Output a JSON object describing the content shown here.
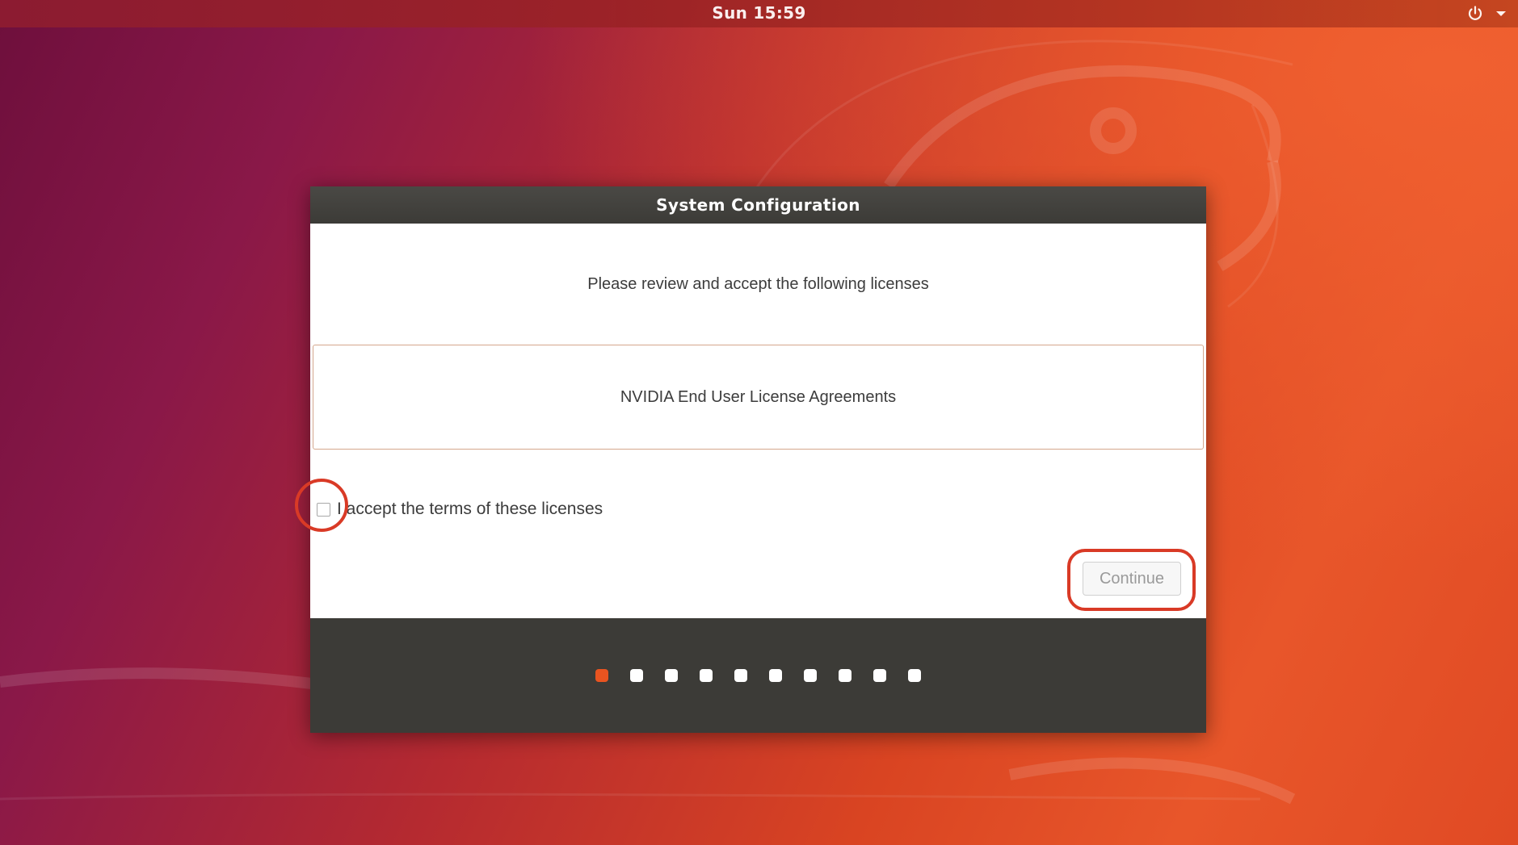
{
  "topbar": {
    "clock": "Sun 15:59",
    "power_icon": "power-icon",
    "menu_icon": "chevron-down-icon"
  },
  "dialog": {
    "title": "System Configuration",
    "instruction": "Please review and accept the following licenses",
    "license_item": "NVIDIA End User License Agreements",
    "accept_checkbox": {
      "label": "I accept the terms of these licenses",
      "checked": false
    },
    "continue_button": {
      "label": "Continue",
      "enabled": false
    }
  },
  "progress": {
    "total_steps": 10,
    "current_step": 1
  },
  "colors": {
    "accent": "#e95420",
    "highlight": "#d93a26",
    "dialog_chrome": "#3c3b37"
  }
}
